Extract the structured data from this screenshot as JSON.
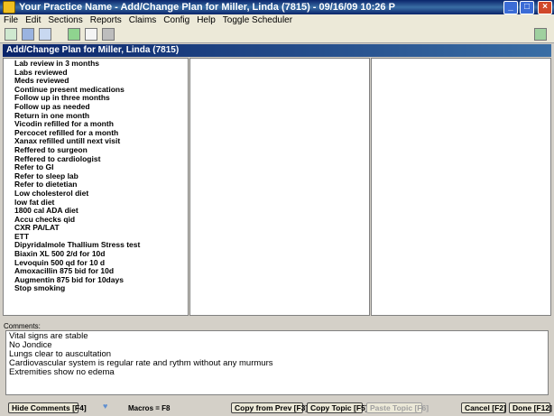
{
  "window": {
    "title": "Your Practice Name -  Add/Change Plan for Miller, Linda (7815) - 09/16/09 10:26 P"
  },
  "menu": [
    "File",
    "Edit",
    "Sections",
    "Reports",
    "Claims",
    "Config",
    "Help",
    "Toggle Scheduler"
  ],
  "toolbar": {
    "icons": [
      "new-document-icon",
      "save-icon",
      "disk-icon",
      "next-icon",
      "copy-icon",
      "print-icon",
      "export-icon"
    ]
  },
  "dialog": {
    "header": "Add/Change Plan for Miller, Linda (7815)"
  },
  "plan_items": [
    "Lab review in 3 months",
    "Labs reviewed",
    "Meds reviewed",
    "Continue present medications",
    "Follow up in three months",
    "Follow up as needed",
    "Return in one month",
    "Vicodin refilled for a month",
    "Percocet refilled for a month",
    "Xanax refilled untill next visit",
    "Reffered to surgeon",
    "Reffered to cardiologist",
    "Refer to GI",
    "Refer to sleep lab",
    "Refer to dietetian",
    "Low cholesterol diet",
    "low fat diet",
    "1800 cal ADA diet",
    "Accu checks qid",
    "CXR PA/LAT",
    "ETT",
    "Dipyridalmole Thallium Stress test",
    "Biaxin XL 500 2/d for 10d",
    "Levoquin 500 qd for 10 d",
    "Amoxacillin 875 bid for 10d",
    "Augmentin 875 bid for 10days",
    "Stop smoking"
  ],
  "comments": {
    "label": "Comments:",
    "lines": [
      "Vital signs are stable",
      "No Jondice",
      "Lungs clear to auscultation",
      "Cardiovascular system is regular rate and rythm without any murmurs",
      "Extremities show no edema"
    ]
  },
  "buttons": {
    "hide_comments": "Hide Comments [F4]",
    "macros": "Macros = F8",
    "copy_from_prev": "Copy from Prev [F3]",
    "copy_topic": "Copy Topic [F5]",
    "paste_topic": "Paste Topic [F6]",
    "cancel": "Cancel [F2]",
    "done": "Done [F12]"
  }
}
